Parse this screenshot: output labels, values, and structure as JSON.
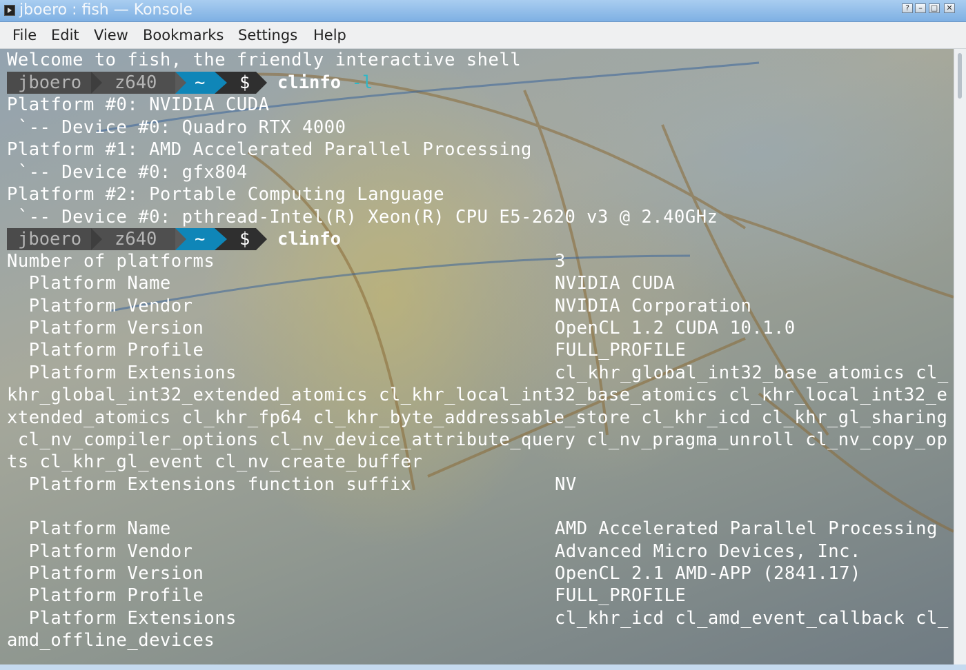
{
  "window": {
    "title": "jboero : fish — Konsole",
    "icon": "terminal-icon"
  },
  "window_controls": [
    {
      "name": "help-button",
      "label": "?"
    },
    {
      "name": "minimize-button",
      "label": "–"
    },
    {
      "name": "maximize-button",
      "label": "□"
    },
    {
      "name": "close-button",
      "label": "✕"
    }
  ],
  "menu": [
    "File",
    "Edit",
    "View",
    "Bookmarks",
    "Settings",
    "Help"
  ],
  "terminal": {
    "welcome": "Welcome to fish, the friendly interactive shell",
    "prompt": {
      "user": "jboero",
      "host": "z640",
      "dir": "~",
      "symbol": "$"
    },
    "cmd1": {
      "command": "clinfo",
      "arg": "-l"
    },
    "list_lines": [
      "Platform #0: NVIDIA CUDA",
      " `-- Device #0: Quadro RTX 4000",
      "Platform #1: AMD Accelerated Parallel Processing",
      " `-- Device #0: gfx804",
      "Platform #2: Portable Computing Language",
      " `-- Device #0: pthread-Intel(R) Xeon(R) CPU E5-2620 v3 @ 2.40GHz"
    ],
    "cmd2": {
      "command": "clinfo"
    },
    "rows": [
      {
        "label": "Number of platforms",
        "value": "3"
      },
      {
        "label": "  Platform Name",
        "value": "NVIDIA CUDA"
      },
      {
        "label": "  Platform Vendor",
        "value": "NVIDIA Corporation"
      },
      {
        "label": "  Platform Version",
        "value": "OpenCL 1.2 CUDA 10.1.0"
      },
      {
        "label": "  Platform Profile",
        "value": "FULL_PROFILE"
      },
      {
        "label": "  Platform Extensions",
        "value": "cl_khr_global_int32_base_atomics cl_"
      }
    ],
    "wrap1": [
      "khr_global_int32_extended_atomics cl_khr_local_int32_base_atomics cl_khr_local_int32_e",
      "xtended_atomics cl_khr_fp64 cl_khr_byte_addressable_store cl_khr_icd cl_khr_gl_sharing",
      " cl_nv_compiler_options cl_nv_device_attribute_query cl_nv_pragma_unroll cl_nv_copy_op",
      "ts cl_khr_gl_event cl_nv_create_buffer"
    ],
    "suffix_row": {
      "label": "  Platform Extensions function suffix",
      "value": "NV"
    },
    "rows2": [
      {
        "label": "  Platform Name",
        "value": "AMD Accelerated Parallel Processing"
      },
      {
        "label": "  Platform Vendor",
        "value": "Advanced Micro Devices, Inc."
      },
      {
        "label": "  Platform Version",
        "value": "OpenCL 2.1 AMD-APP (2841.17)"
      },
      {
        "label": "  Platform Profile",
        "value": "FULL_PROFILE"
      },
      {
        "label": "  Platform Extensions",
        "value": "cl_khr_icd cl_amd_event_callback cl_"
      }
    ],
    "wrap2": [
      "amd_offline_devices"
    ]
  }
}
